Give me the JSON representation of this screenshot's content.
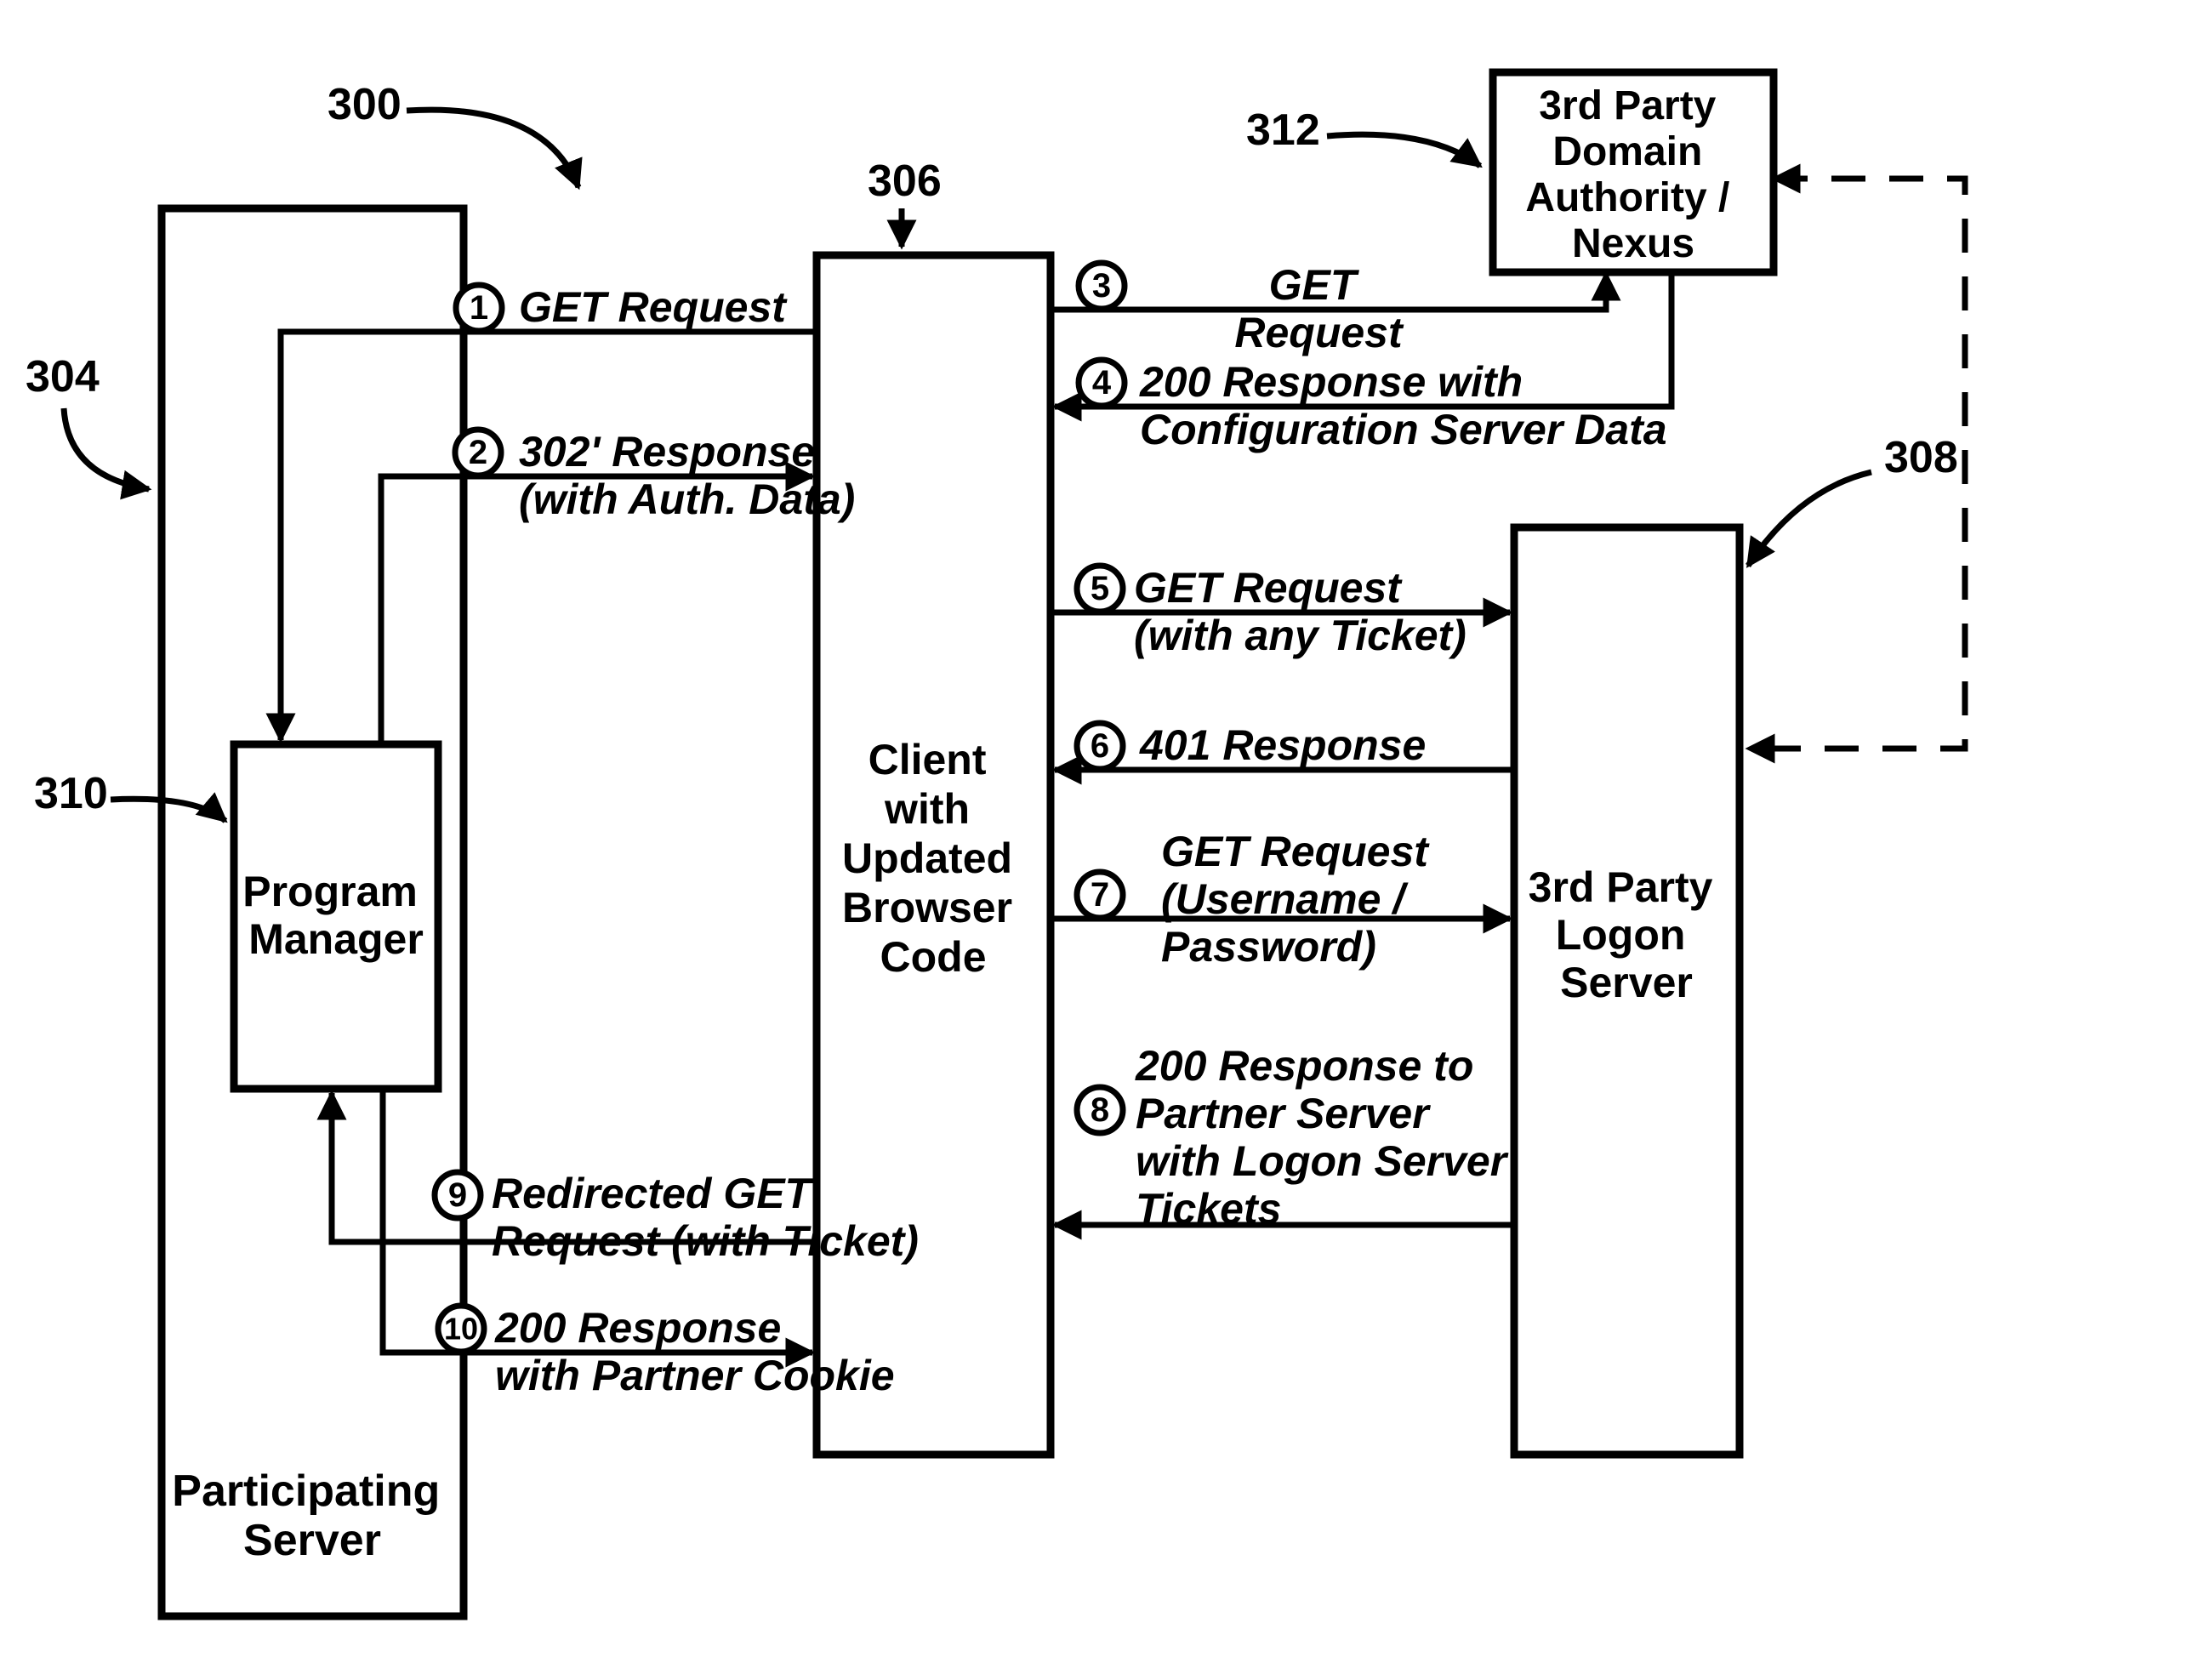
{
  "refs": {
    "r300": "300",
    "r304": "304",
    "r306": "306",
    "r308": "308",
    "r310": "310",
    "r312": "312"
  },
  "boxes": {
    "participating_server": "Participating\nServer",
    "program_manager": "Program\nManager",
    "client": "Client\nwith\nUpdated\nBrowser\nCode",
    "nexus": "3rd Party\nDomain\nAuthority /\nNexus",
    "logon_server": "3rd Party\nLogon\nServer"
  },
  "steps": {
    "s1": {
      "n": "1",
      "text": "GET Request"
    },
    "s2": {
      "n": "2",
      "text": "302' Response\n(with Auth. Data)"
    },
    "s3": {
      "n": "3",
      "text": "GET\nRequest"
    },
    "s4": {
      "n": "4",
      "text": "200 Response with\nConfiguration Server Data"
    },
    "s5": {
      "n": "5",
      "text": "GET Request\n(with any Ticket)"
    },
    "s6": {
      "n": "6",
      "text": "401 Response"
    },
    "s7": {
      "n": "7",
      "text": "GET Request\n(Username /\nPassword)"
    },
    "s8": {
      "n": "8",
      "text": "200 Response to\nPartner Server\nwith Logon Server\nTickets"
    },
    "s9": {
      "n": "9",
      "text": "Redirected GET\nRequest (with Ticket)"
    },
    "s10": {
      "n": "10",
      "text": "200 Response\nwith Partner Cookie"
    }
  }
}
